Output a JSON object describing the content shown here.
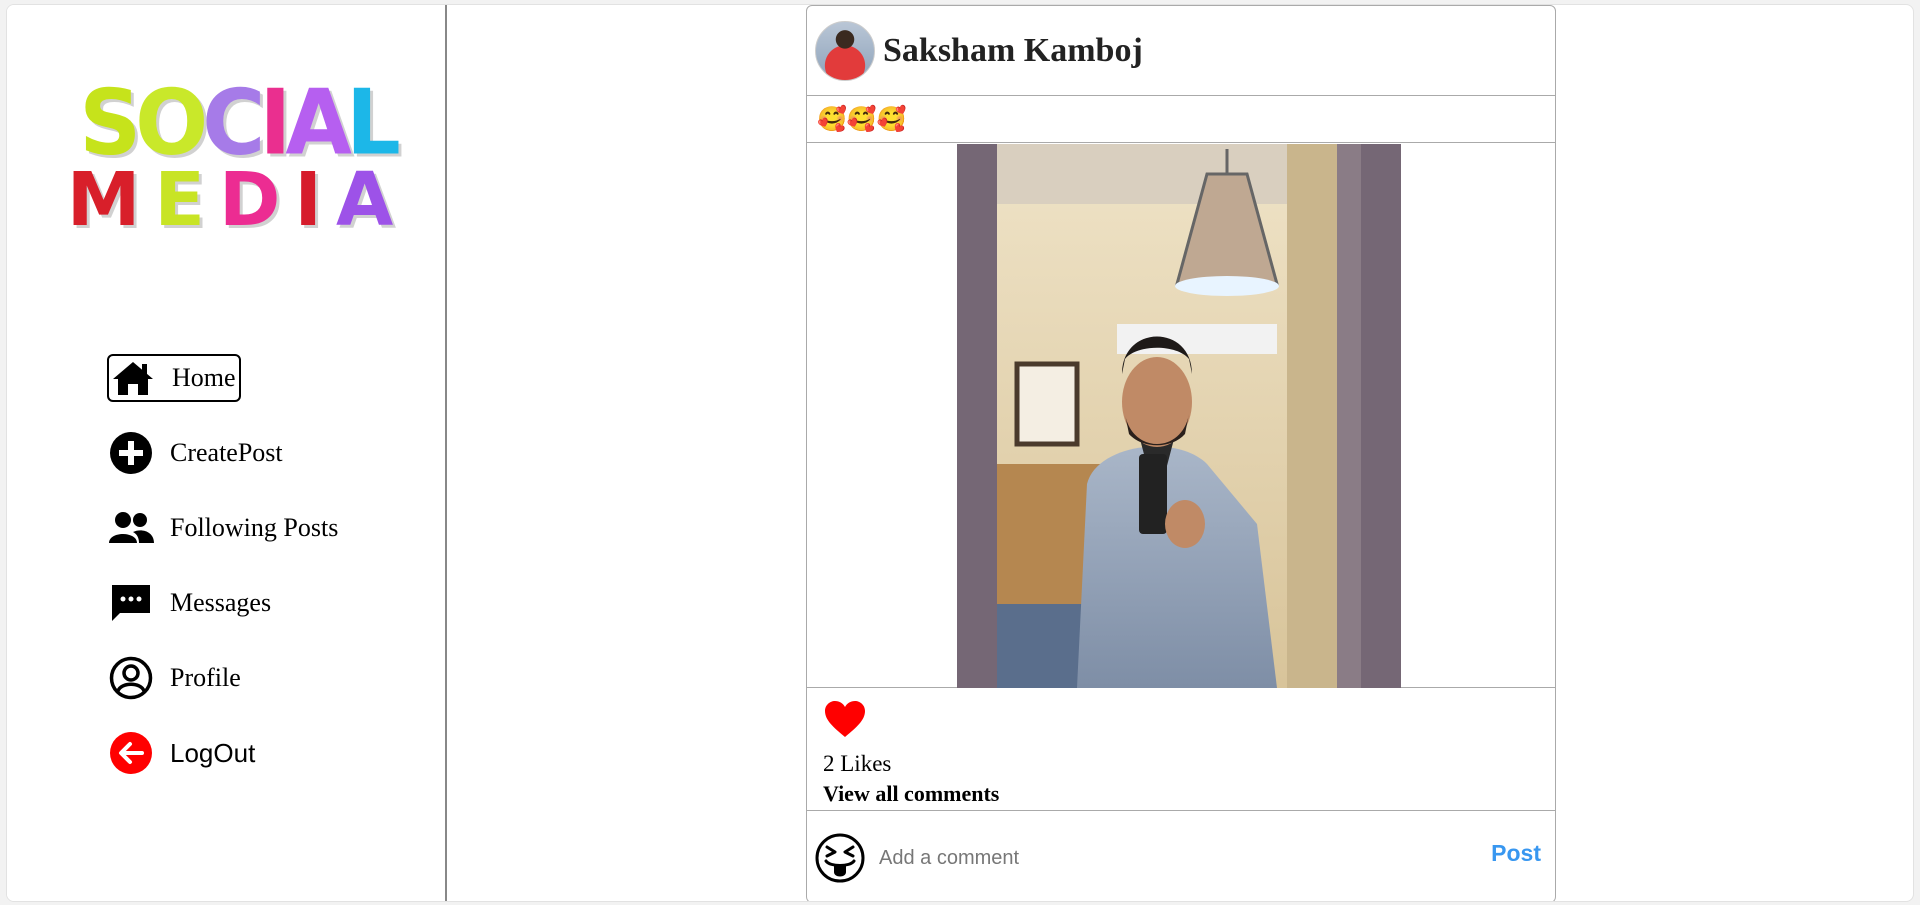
{
  "logo": {
    "top_letters": [
      "S",
      "O",
      "C",
      "I",
      "A",
      "L"
    ],
    "bottom_letters": [
      "M",
      "E",
      "D",
      "I",
      "A"
    ]
  },
  "nav": {
    "items": [
      {
        "label": "Home",
        "icon": "home-icon"
      },
      {
        "label": "CreatePost",
        "icon": "plus-circle-icon"
      },
      {
        "label": "Following Posts",
        "icon": "users-icon"
      },
      {
        "label": "Messages",
        "icon": "message-icon"
      },
      {
        "label": "Profile",
        "icon": "user-circle-icon"
      },
      {
        "label": "LogOut",
        "icon": "arrow-left-circle-icon"
      }
    ]
  },
  "post": {
    "author": "Saksham Kamboj",
    "caption": "🥰🥰🥰",
    "likes_text": "2 Likes",
    "view_comments": "View all comments",
    "liked": true
  },
  "comment": {
    "placeholder": "Add a comment",
    "post_label": "Post"
  },
  "colors": {
    "like": "#ff0000",
    "post_button": "#3897f0",
    "logout": "#ff0000"
  }
}
